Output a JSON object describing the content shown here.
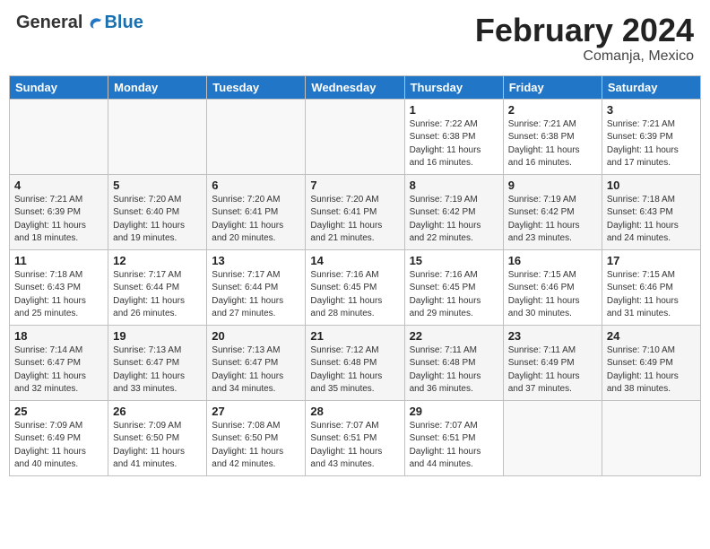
{
  "header": {
    "logo": {
      "general": "General",
      "blue": "Blue"
    },
    "title": "February 2024",
    "location": "Comanja, Mexico"
  },
  "weekdays": [
    "Sunday",
    "Monday",
    "Tuesday",
    "Wednesday",
    "Thursday",
    "Friday",
    "Saturday"
  ],
  "weeks": [
    [
      {
        "day": "",
        "info": ""
      },
      {
        "day": "",
        "info": ""
      },
      {
        "day": "",
        "info": ""
      },
      {
        "day": "",
        "info": ""
      },
      {
        "day": "1",
        "info": "Sunrise: 7:22 AM\nSunset: 6:38 PM\nDaylight: 11 hours\nand 16 minutes."
      },
      {
        "day": "2",
        "info": "Sunrise: 7:21 AM\nSunset: 6:38 PM\nDaylight: 11 hours\nand 16 minutes."
      },
      {
        "day": "3",
        "info": "Sunrise: 7:21 AM\nSunset: 6:39 PM\nDaylight: 11 hours\nand 17 minutes."
      }
    ],
    [
      {
        "day": "4",
        "info": "Sunrise: 7:21 AM\nSunset: 6:39 PM\nDaylight: 11 hours\nand 18 minutes."
      },
      {
        "day": "5",
        "info": "Sunrise: 7:20 AM\nSunset: 6:40 PM\nDaylight: 11 hours\nand 19 minutes."
      },
      {
        "day": "6",
        "info": "Sunrise: 7:20 AM\nSunset: 6:41 PM\nDaylight: 11 hours\nand 20 minutes."
      },
      {
        "day": "7",
        "info": "Sunrise: 7:20 AM\nSunset: 6:41 PM\nDaylight: 11 hours\nand 21 minutes."
      },
      {
        "day": "8",
        "info": "Sunrise: 7:19 AM\nSunset: 6:42 PM\nDaylight: 11 hours\nand 22 minutes."
      },
      {
        "day": "9",
        "info": "Sunrise: 7:19 AM\nSunset: 6:42 PM\nDaylight: 11 hours\nand 23 minutes."
      },
      {
        "day": "10",
        "info": "Sunrise: 7:18 AM\nSunset: 6:43 PM\nDaylight: 11 hours\nand 24 minutes."
      }
    ],
    [
      {
        "day": "11",
        "info": "Sunrise: 7:18 AM\nSunset: 6:43 PM\nDaylight: 11 hours\nand 25 minutes."
      },
      {
        "day": "12",
        "info": "Sunrise: 7:17 AM\nSunset: 6:44 PM\nDaylight: 11 hours\nand 26 minutes."
      },
      {
        "day": "13",
        "info": "Sunrise: 7:17 AM\nSunset: 6:44 PM\nDaylight: 11 hours\nand 27 minutes."
      },
      {
        "day": "14",
        "info": "Sunrise: 7:16 AM\nSunset: 6:45 PM\nDaylight: 11 hours\nand 28 minutes."
      },
      {
        "day": "15",
        "info": "Sunrise: 7:16 AM\nSunset: 6:45 PM\nDaylight: 11 hours\nand 29 minutes."
      },
      {
        "day": "16",
        "info": "Sunrise: 7:15 AM\nSunset: 6:46 PM\nDaylight: 11 hours\nand 30 minutes."
      },
      {
        "day": "17",
        "info": "Sunrise: 7:15 AM\nSunset: 6:46 PM\nDaylight: 11 hours\nand 31 minutes."
      }
    ],
    [
      {
        "day": "18",
        "info": "Sunrise: 7:14 AM\nSunset: 6:47 PM\nDaylight: 11 hours\nand 32 minutes."
      },
      {
        "day": "19",
        "info": "Sunrise: 7:13 AM\nSunset: 6:47 PM\nDaylight: 11 hours\nand 33 minutes."
      },
      {
        "day": "20",
        "info": "Sunrise: 7:13 AM\nSunset: 6:47 PM\nDaylight: 11 hours\nand 34 minutes."
      },
      {
        "day": "21",
        "info": "Sunrise: 7:12 AM\nSunset: 6:48 PM\nDaylight: 11 hours\nand 35 minutes."
      },
      {
        "day": "22",
        "info": "Sunrise: 7:11 AM\nSunset: 6:48 PM\nDaylight: 11 hours\nand 36 minutes."
      },
      {
        "day": "23",
        "info": "Sunrise: 7:11 AM\nSunset: 6:49 PM\nDaylight: 11 hours\nand 37 minutes."
      },
      {
        "day": "24",
        "info": "Sunrise: 7:10 AM\nSunset: 6:49 PM\nDaylight: 11 hours\nand 38 minutes."
      }
    ],
    [
      {
        "day": "25",
        "info": "Sunrise: 7:09 AM\nSunset: 6:49 PM\nDaylight: 11 hours\nand 40 minutes."
      },
      {
        "day": "26",
        "info": "Sunrise: 7:09 AM\nSunset: 6:50 PM\nDaylight: 11 hours\nand 41 minutes."
      },
      {
        "day": "27",
        "info": "Sunrise: 7:08 AM\nSunset: 6:50 PM\nDaylight: 11 hours\nand 42 minutes."
      },
      {
        "day": "28",
        "info": "Sunrise: 7:07 AM\nSunset: 6:51 PM\nDaylight: 11 hours\nand 43 minutes."
      },
      {
        "day": "29",
        "info": "Sunrise: 7:07 AM\nSunset: 6:51 PM\nDaylight: 11 hours\nand 44 minutes."
      },
      {
        "day": "",
        "info": ""
      },
      {
        "day": "",
        "info": ""
      }
    ]
  ]
}
